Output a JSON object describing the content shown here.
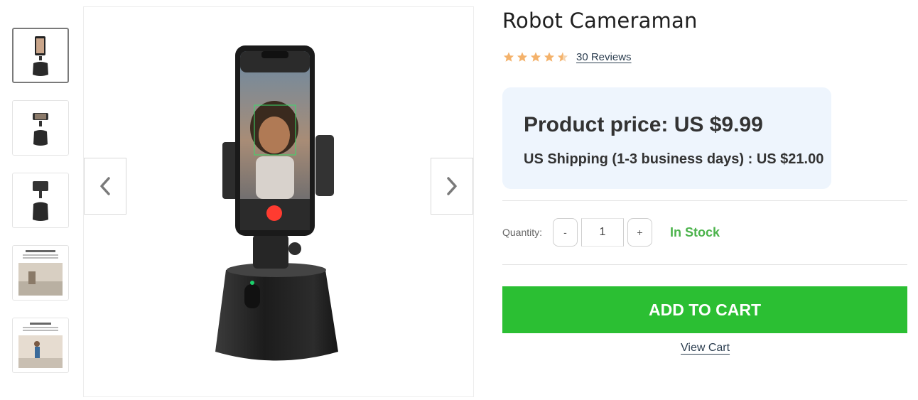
{
  "product": {
    "title": "Robot Cameraman",
    "rating": 4.5,
    "reviews_label": "30 Reviews",
    "star_color": "#f4b26b"
  },
  "price": {
    "main": "Product price: US $9.99",
    "shipping": "US Shipping (1-3 business days) : US $21.00"
  },
  "quantity": {
    "label": "Quantity:",
    "minus": "-",
    "plus": "+",
    "value": "1",
    "stock": "In Stock"
  },
  "actions": {
    "add_to_cart": "ADD TO CART",
    "view_cart": "View Cart"
  },
  "gallery": {
    "thumbnails": [
      {
        "name": "front view",
        "active": true
      },
      {
        "name": "side view",
        "active": false
      },
      {
        "name": "back view",
        "active": false
      },
      {
        "name": "object tracking infographic",
        "active": false,
        "caption": "Intelligent Object Tracking"
      },
      {
        "name": "facial detection infographic",
        "active": false,
        "caption": "Facial Detection"
      }
    ],
    "prev_icon": "chevron-left-icon",
    "next_icon": "chevron-right-icon"
  },
  "colors": {
    "accent_green": "#2bbf33",
    "stock_green": "#4cb34c",
    "price_bg": "#eef5fd"
  }
}
